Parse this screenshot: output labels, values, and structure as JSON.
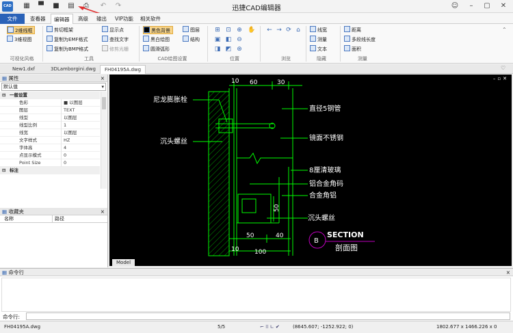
{
  "titlebar": {
    "logo": "CAD",
    "title": "迅捷CAD编辑器",
    "quick_icons": [
      "grid-icon",
      "open-folder-icon",
      "save-icon",
      "save-as-icon",
      "print-icon",
      "undo-icon",
      "redo-icon"
    ],
    "window_icons": [
      "help-icon",
      "minimize-icon",
      "restore-icon",
      "close-icon"
    ]
  },
  "menu": {
    "file": "文件",
    "items": [
      "查看器",
      "编辑器",
      "高级",
      "输出",
      "VIP功能",
      "相关软件"
    ]
  },
  "ribbon": {
    "visual_style": {
      "items": [
        "2维线框",
        "3维视图"
      ],
      "label": "可视化风格"
    },
    "tools": {
      "items": [
        "剪切框架",
        "复制为EMF格式",
        "复制为BMP格式",
        "显示点",
        "查找文字",
        "修剪光栅"
      ],
      "label": "工具"
    },
    "cad_settings": {
      "items": [
        "黑色背景",
        "黑白绘图",
        "圆滑弧形",
        "图层",
        "结构"
      ],
      "label": "CAD绘图设置"
    },
    "position": {
      "label": "位置"
    },
    "browse": {
      "label": "浏览"
    },
    "hide": {
      "items": [
        "线宽",
        "测量",
        "文本"
      ],
      "label": "隐藏"
    },
    "measure": {
      "items": [
        "距离",
        "多段线长度",
        "面积"
      ],
      "label": "测量"
    }
  },
  "doc_tabs": [
    "New1.dxf",
    "3DLamborgini.dwg",
    "FH04195A.dwg"
  ],
  "properties": {
    "title": "属性",
    "default": "默认值",
    "close": "×",
    "category_general": "一般设置",
    "rows": [
      {
        "k": "色彩",
        "v": "以图层"
      },
      {
        "k": "图层",
        "v": "TEXT"
      },
      {
        "k": "线型",
        "v": "以图层"
      },
      {
        "k": "线型比例",
        "v": "1"
      },
      {
        "k": "线宽",
        "v": "以图层"
      },
      {
        "k": "文字样式",
        "v": "HZ"
      },
      {
        "k": "字体高",
        "v": "4"
      },
      {
        "k": "点显示模式",
        "v": "0"
      },
      {
        "k": "Point Size",
        "v": "0"
      }
    ],
    "category_mark": "标注"
  },
  "favorites": {
    "title": "收藏夹",
    "col_name": "名称",
    "col_path": "路径"
  },
  "drawing": {
    "dims": [
      "10",
      "60",
      "30",
      "10",
      "50",
      "40",
      "100",
      "50"
    ],
    "labels": [
      "尼龙膨胀栓",
      "直径5钢管",
      "沉头螺丝",
      "镜面不锈钢",
      "8厘清玻璃",
      "铝合金角码",
      "合金角铝",
      "沉头螺丝"
    ],
    "section_letter": "B",
    "section_title": "SECTION",
    "section_sub": "剖面图",
    "model_tab": "Model"
  },
  "command": {
    "title": "命令行",
    "prompt": "命令行:"
  },
  "status": {
    "file": "FH04195A.dwg",
    "page": "5/5",
    "coords": "(8645.607; -1252.922; 0)",
    "size": "1802.677 x 1466.226 x 0"
  },
  "colors": {
    "accent": "#2a62b8",
    "canvas": "#000000",
    "cad_line": "#00ff00",
    "cad_text": "#ffffff",
    "section_line": "#c000c0"
  }
}
